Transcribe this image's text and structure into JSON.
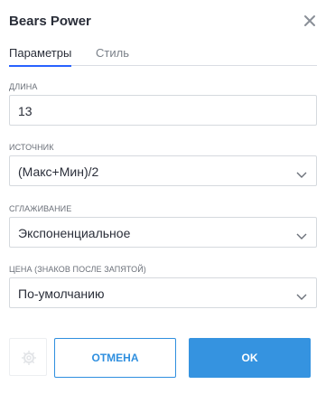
{
  "dialog": {
    "title": "Bears Power",
    "close_icon": "close-icon"
  },
  "tabs": [
    {
      "label": "Параметры",
      "active": true
    },
    {
      "label": "Стиль",
      "active": false
    }
  ],
  "fields": {
    "length": {
      "label": "ДЛИНА",
      "value": "13"
    },
    "source": {
      "label": "ИСТОЧНИК",
      "value": "(Макс+Мин)/2"
    },
    "smoothing": {
      "label": "СГЛАЖИВАНИЕ",
      "value": "Экспоненциальное"
    },
    "price": {
      "label": "ЦЕНА (ЗНАКОВ ПОСЛЕ ЗАПЯТОЙ)",
      "value": "По-умолчанию"
    }
  },
  "footer": {
    "settings_icon": "gear-icon",
    "cancel_label": "ОТМЕНА",
    "ok_label": "OK"
  },
  "colors": {
    "accent": "#2962ff",
    "button_blue": "#3593e0",
    "text": "#2a2e39"
  }
}
